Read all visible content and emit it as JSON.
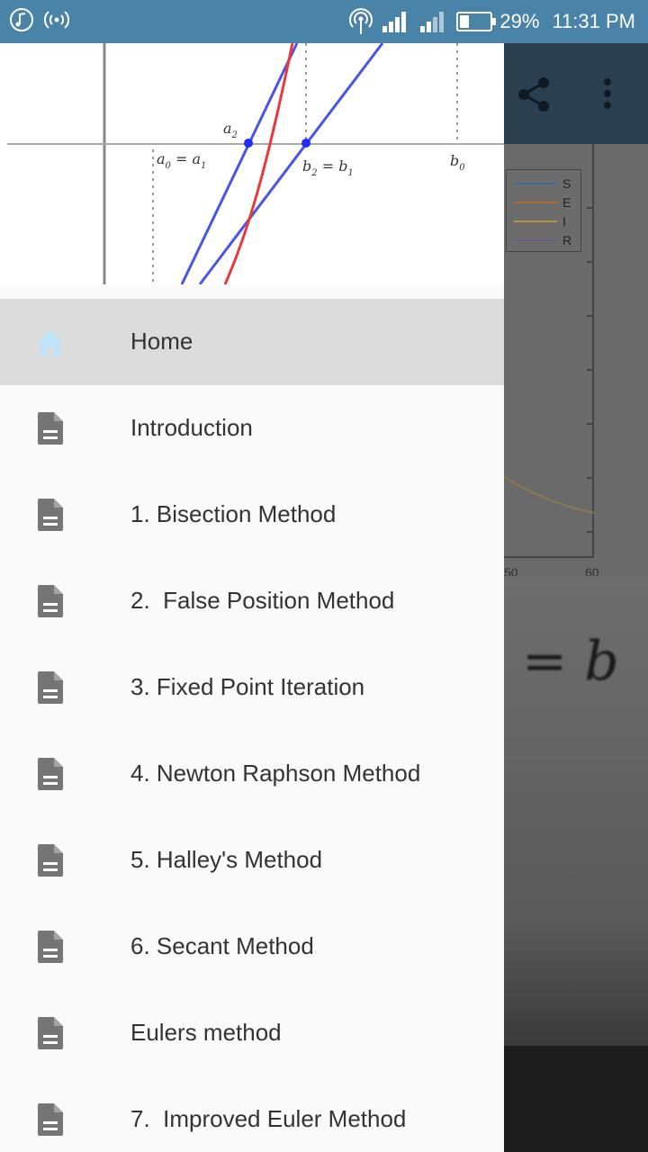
{
  "status_bar": {
    "battery_percent": "29%",
    "time": "11:31 PM",
    "battery_level": 0.29,
    "left_icons": [
      "music-note-icon",
      "broadcast-icon"
    ],
    "right_icons": [
      "hotspot-icon",
      "signal-icon",
      "signal-icon",
      "battery-icon"
    ]
  },
  "background_app": {
    "toolbar_icons": [
      "share-icon",
      "overflow-menu-icon"
    ],
    "chart_legend": [
      "S",
      "E",
      "I",
      "R"
    ],
    "legend_colors": [
      "#3a6fa0",
      "#b06a3a",
      "#b0953a",
      "#6a5a8a"
    ],
    "x_tick_labels": [
      "50",
      "60"
    ],
    "math_fragment": "= b"
  },
  "drawer": {
    "header_figure": {
      "labels": {
        "a2": "a",
        "a2_sub": "2",
        "a0_eq_a1": "a",
        "a0_sub": "0",
        "eq1": " = a",
        "a1_sub": "1",
        "b2_eq_b1": "b",
        "b2_sub": "2",
        "eq2": " = b",
        "b1_sub": "1",
        "b0": "b",
        "b0_sub": "0"
      }
    },
    "menu": [
      {
        "label": "Home",
        "icon": "home-icon",
        "active": true
      },
      {
        "label": "Introduction",
        "icon": "document-icon",
        "active": false
      },
      {
        "label": "1. Bisection Method",
        "icon": "document-icon",
        "active": false
      },
      {
        "label": "2.  False Position Method",
        "icon": "document-icon",
        "active": false
      },
      {
        "label": "3. Fixed Point Iteration",
        "icon": "document-icon",
        "active": false
      },
      {
        "label": "4. Newton Raphson Method",
        "icon": "document-icon",
        "active": false
      },
      {
        "label": "5. Halley's Method",
        "icon": "document-icon",
        "active": false
      },
      {
        "label": "6. Secant Method",
        "icon": "document-icon",
        "active": false
      },
      {
        "label": "Eulers method",
        "icon": "document-icon",
        "active": false
      },
      {
        "label": "7.  Improved Euler Method",
        "icon": "document-icon",
        "active": false
      }
    ],
    "colors": {
      "active_bg": "#dcdcdc",
      "home_icon": "#bfe3f7",
      "doc_icon": "#757575",
      "text": "#333333"
    }
  }
}
